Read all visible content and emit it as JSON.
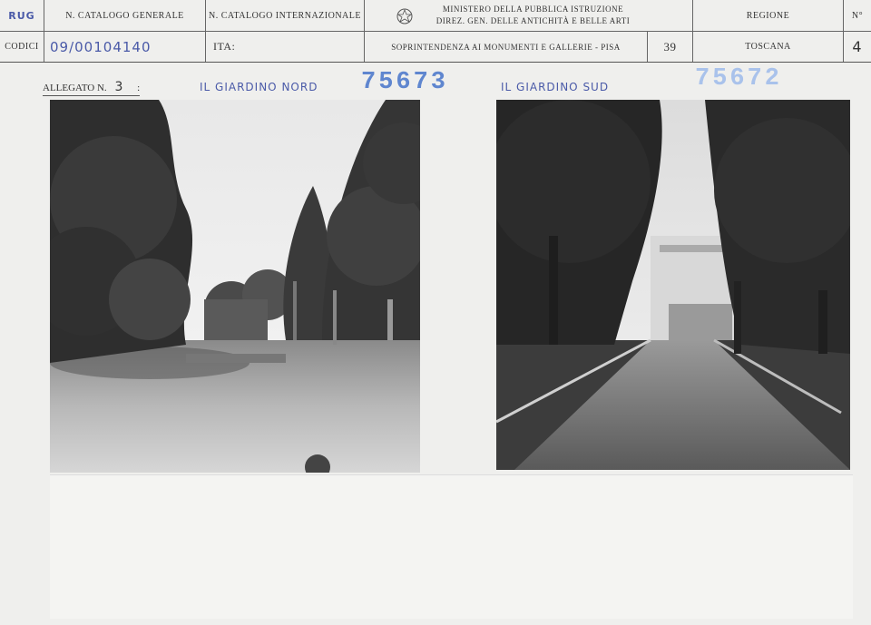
{
  "header": {
    "corner_mark": "RUG",
    "corner_label": "CODICI",
    "catalogo_generale_label": "N. CATALOGO GENERALE",
    "catalogo_generale_value": "09/00104140",
    "catalogo_internazionale_label": "N. CATALOGO INTERNAZIONALE",
    "ita_label": "ITA:",
    "ministero_line1": "MINISTERO DELLA PUBBLICA ISTRUZIONE",
    "ministero_line2": "DIREZ. GEN. DELLE ANTICHITÀ E BELLE ARTI",
    "soprintendenza": "SOPRINTENDENZA AI MONUMENTI E GALLERIE - PISA",
    "code_number": "39",
    "regione_label": "REGIONE",
    "regione_value": "TOSCANA",
    "numero_label": "N°",
    "numero_value": "4"
  },
  "allegato": {
    "label": "ALLEGATO N.",
    "value": "3",
    "colon": ":"
  },
  "photos": [
    {
      "caption": "IL GIARDINO NORD",
      "stamp": "75673"
    },
    {
      "caption": "IL GIARDINO SUD",
      "stamp": "75672"
    }
  ]
}
